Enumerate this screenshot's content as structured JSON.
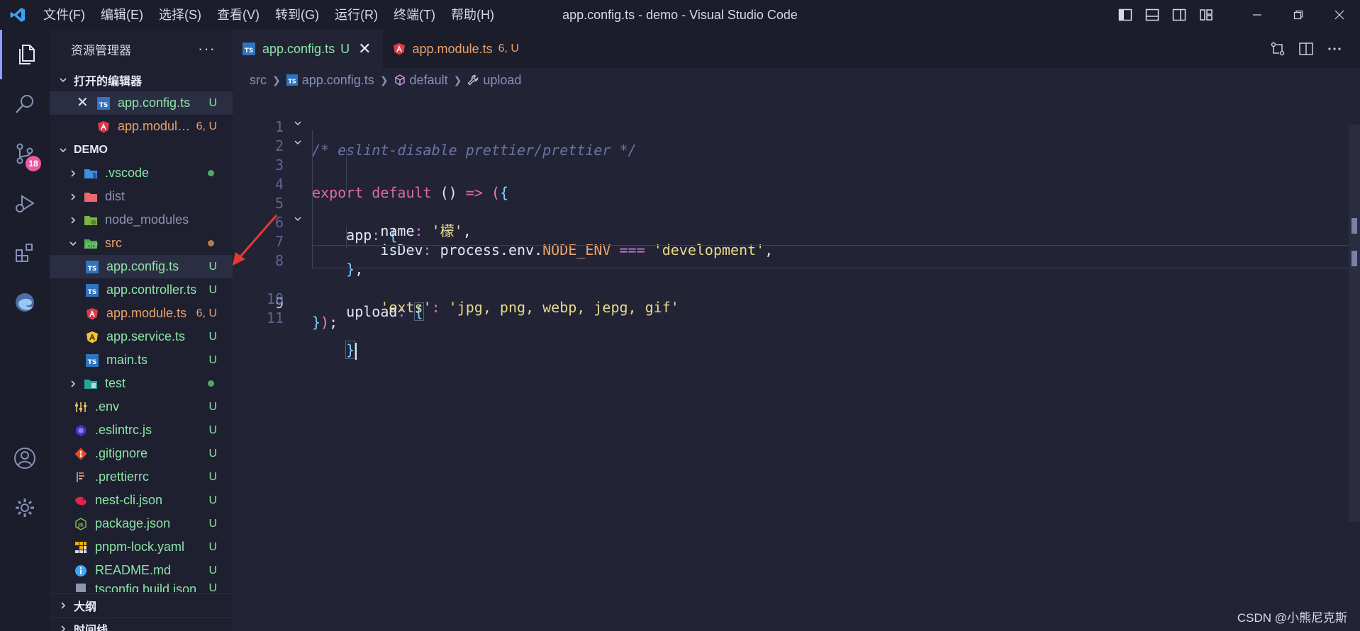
{
  "titlebar": {
    "menu": [
      "文件(F)",
      "编辑(E)",
      "选择(S)",
      "查看(V)",
      "转到(G)",
      "运行(R)",
      "终端(T)",
      "帮助(H)"
    ],
    "window_title": "app.config.ts - demo - Visual Studio Code"
  },
  "activity": {
    "source_control_badge": "18"
  },
  "sidebar": {
    "title": "资源管理器",
    "more": "···",
    "open_editors_label": "打开的编辑器",
    "open_editors": [
      {
        "name": "app.config.ts",
        "status": "U",
        "icon": "ts-icon"
      },
      {
        "name": "app.module.ts",
        "status": "6, U",
        "icon": "angular-icon"
      }
    ],
    "workspace_label": "DEMO",
    "tree": [
      {
        "name": ".vscode",
        "type": "folder",
        "status": "dot-green",
        "icon": "vscode-folder-icon"
      },
      {
        "name": "dist",
        "type": "folder",
        "status": "",
        "icon": "dist-folder-icon"
      },
      {
        "name": "node_modules",
        "type": "folder",
        "status": "",
        "icon": "node-folder-icon"
      },
      {
        "name": "src",
        "type": "folder-open",
        "status": "dot-orange",
        "icon": "src-folder-icon"
      },
      {
        "name": "app.config.ts",
        "type": "file",
        "status": "U",
        "icon": "ts-icon"
      },
      {
        "name": "app.controller.ts",
        "type": "file",
        "status": "U",
        "icon": "ts-icon"
      },
      {
        "name": "app.module.ts",
        "type": "file",
        "status": "6, U",
        "icon": "angular-icon"
      },
      {
        "name": "app.service.ts",
        "type": "file",
        "status": "U",
        "icon": "angular-yellow-icon"
      },
      {
        "name": "main.ts",
        "type": "file",
        "status": "U",
        "icon": "ts-icon"
      },
      {
        "name": "test",
        "type": "folder",
        "status": "dot-green",
        "icon": "test-folder-icon"
      },
      {
        "name": ".env",
        "type": "file",
        "status": "U",
        "icon": "env-icon"
      },
      {
        "name": ".eslintrc.js",
        "type": "file",
        "status": "U",
        "icon": "eslint-icon"
      },
      {
        "name": ".gitignore",
        "type": "file",
        "status": "U",
        "icon": "git-icon"
      },
      {
        "name": ".prettierrc",
        "type": "file",
        "status": "U",
        "icon": "prettier-icon"
      },
      {
        "name": "nest-cli.json",
        "type": "file",
        "status": "U",
        "icon": "nest-icon"
      },
      {
        "name": "package.json",
        "type": "file",
        "status": "U",
        "icon": "npm-icon"
      },
      {
        "name": "pnpm-lock.yaml",
        "type": "file",
        "status": "U",
        "icon": "pnpm-icon"
      },
      {
        "name": "README.md",
        "type": "file",
        "status": "U",
        "icon": "info-icon"
      },
      {
        "name": "tsconfig.build.json",
        "type": "file",
        "status": "U",
        "icon": "tsconfig-icon"
      }
    ],
    "outline_label": "大纲",
    "timeline_label": "时间线"
  },
  "tabs": [
    {
      "label": "app.config.ts",
      "status": "U",
      "active": true
    },
    {
      "label": "app.module.ts",
      "status": "6, U",
      "active": false
    }
  ],
  "breadcrumb": {
    "folder": "src",
    "file": "app.config.ts",
    "symbol1": "default",
    "symbol2": "upload"
  },
  "code": {
    "line_numbers": [
      "1",
      "2",
      "3",
      "4",
      "5",
      "6",
      "7",
      "8",
      "9",
      "10",
      "11"
    ],
    "current_line": "9"
  },
  "watermark": "CSDN @小熊尼克斯",
  "colors": {
    "accent": "#8aa0ff",
    "badge": "#e95aa2",
    "untracked_green": "#8ce3a6",
    "modified_orange": "#e9a36d"
  }
}
